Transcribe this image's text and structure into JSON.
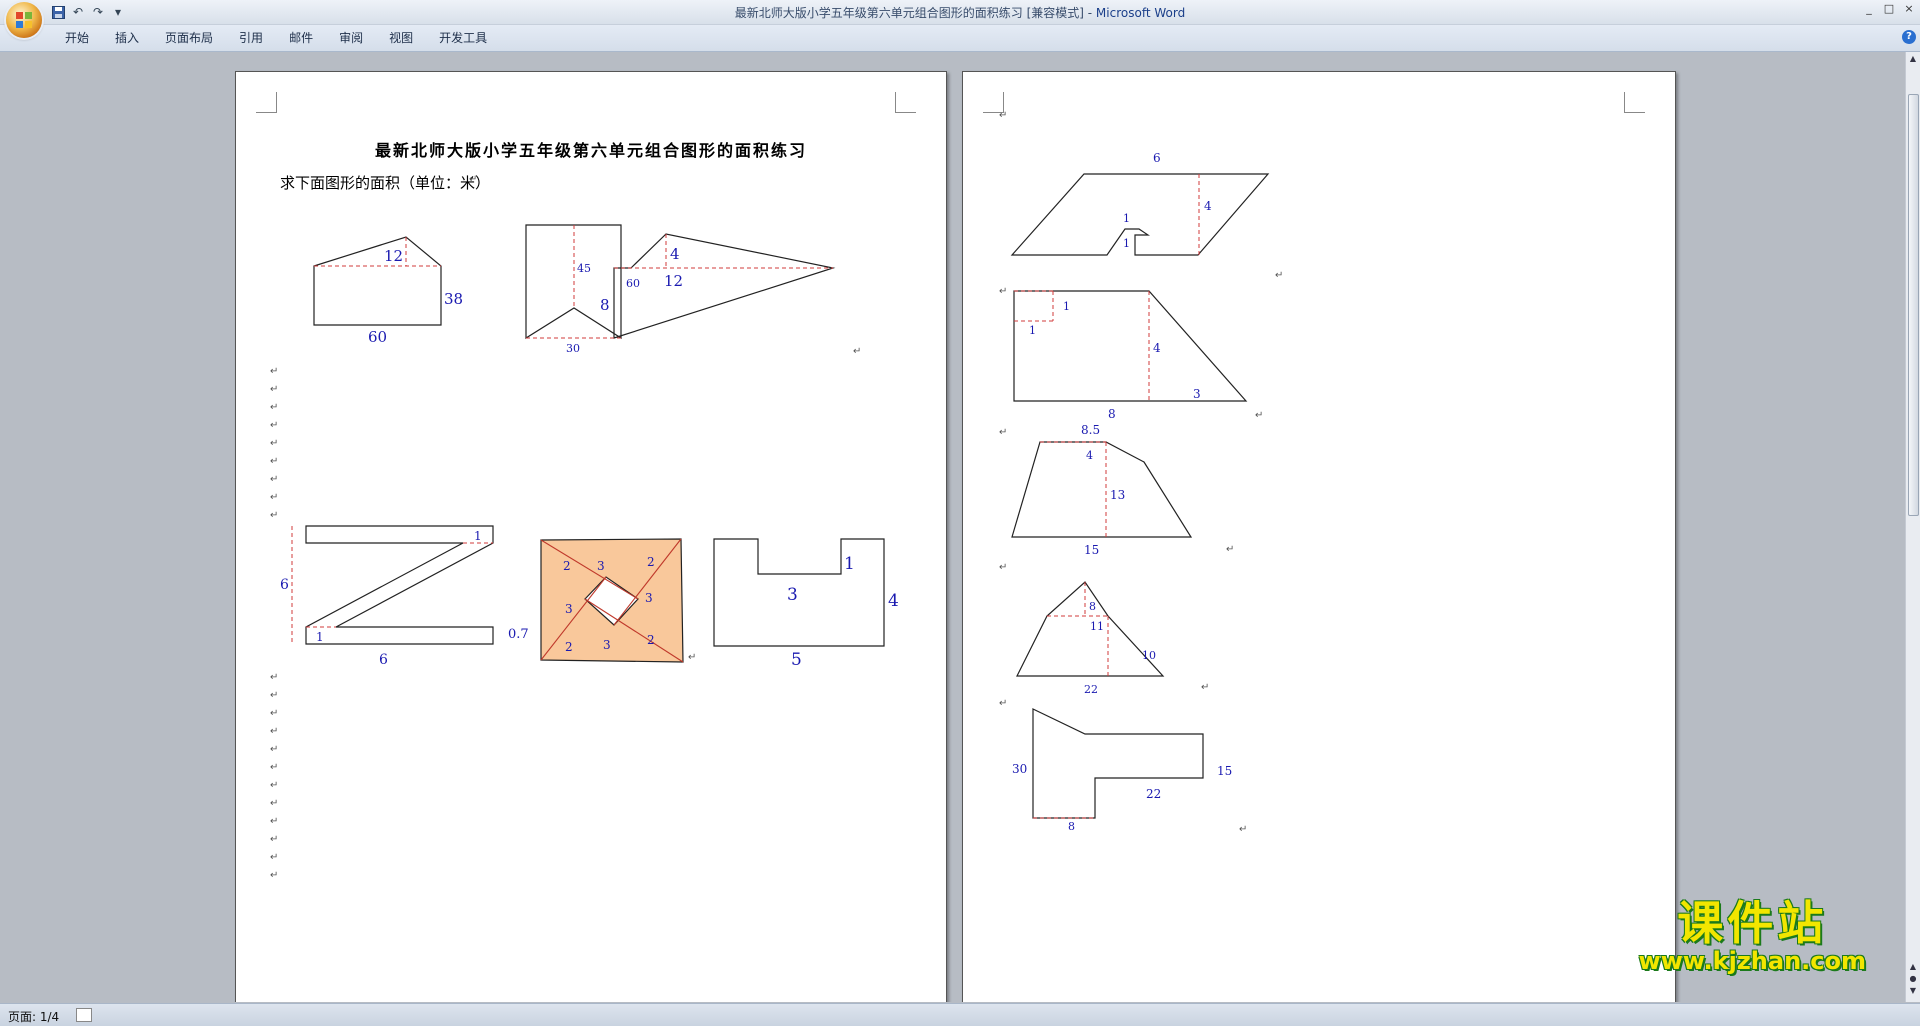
{
  "window": {
    "title": "最新北师大版小学五年级第六单元组合图形的面积练习 [兼容模式] - ",
    "app_name": "Microsoft Word",
    "controls": [
      "_",
      "□",
      "×"
    ]
  },
  "ribbon": {
    "tabs": [
      "开始",
      "插入",
      "页面布局",
      "引用",
      "邮件",
      "审阅",
      "视图",
      "开发工具"
    ],
    "help": "?"
  },
  "document": {
    "title": "最新北师大版小学五年级第六单元组合图形的面积练习",
    "instruction": "求下面图形的面积（单位：米）",
    "paragraph_mark": "↵"
  },
  "figures_page1": {
    "fig1": {
      "top": "12",
      "right": "38",
      "bottom": "60"
    },
    "fig2": {
      "inner": "45",
      "right": "60",
      "bottom": "30"
    },
    "fig3": {
      "top": "4",
      "mid": "12",
      "left": "8"
    },
    "fig4": {
      "top": "1",
      "bottom_in": "1",
      "left": "6",
      "bottom": "6"
    },
    "fig5": {
      "a": "2",
      "b": "3",
      "c": "2",
      "d": "3",
      "e": "3",
      "f": "2",
      "g": "3",
      "h": "2",
      "left": "0.7"
    },
    "fig6": {
      "top": "1",
      "mid": "3",
      "right": "4",
      "bottom": "5"
    }
  },
  "figures_page2": {
    "fig1": {
      "top": "6",
      "right": "4",
      "a": "1",
      "b": "1"
    },
    "fig2": {
      "a": "1",
      "b": "1",
      "mid": "4",
      "bottom": "8",
      "right": "3"
    },
    "fig3": {
      "top": "8.5",
      "a": "4",
      "right": "13",
      "bottom": "15"
    },
    "fig4": {
      "a": "8",
      "b": "11",
      "right": "10",
      "bottom": "22"
    },
    "fig5": {
      "left": "30",
      "right": "15",
      "bottom": "22",
      "b": "8"
    }
  },
  "status": {
    "page": "页面: 1/4"
  },
  "watermark": {
    "text": "课件站",
    "url": "www.kjzhan.com"
  },
  "colors": {
    "label": "#1a1ab0",
    "dash": "#d23b3b",
    "fill": "#f9c89b"
  }
}
